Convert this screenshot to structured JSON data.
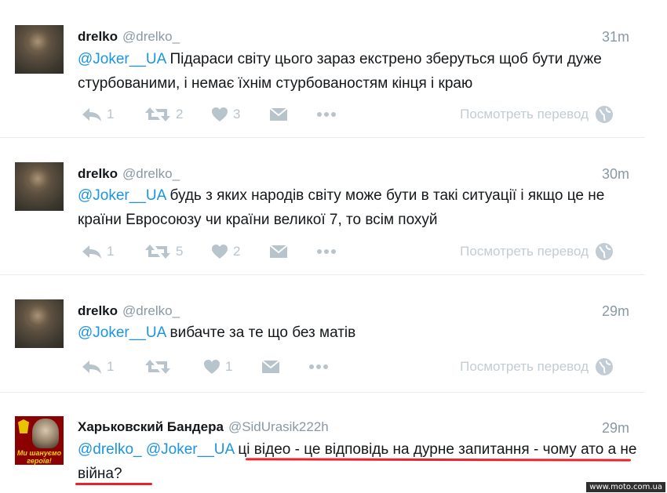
{
  "tweets": [
    {
      "name": "drelko",
      "handle": "@drelko_",
      "time": "31m",
      "mentions": "@Joker__UA",
      "text": " Підараси світу цього зараз екстрено зберуться щоб бути  дуже стурбованими, і немає їхнім стурбованостям кінця і краю",
      "reply_count": "1",
      "retweet_count": "2",
      "like_count": "3",
      "translate_label": "Посмотреть перевод"
    },
    {
      "name": "drelko",
      "handle": "@drelko_",
      "time": "30m",
      "mentions": "@Joker__UA",
      "text": " будь з яких народів світу може бути в такі ситуації і якщо це не країни Евросоюзу чи країни великої 7, то всім похуй",
      "reply_count": "1",
      "retweet_count": "5",
      "like_count": "2",
      "translate_label": "Посмотреть перевод"
    },
    {
      "name": "drelko",
      "handle": "@drelko_",
      "time": "29m",
      "mentions": "@Joker__UA",
      "text": " вибачте за те що без матів",
      "reply_count": "1",
      "retweet_count": "",
      "like_count": "1",
      "translate_label": "Посмотреть перевод"
    },
    {
      "name": "Харьковский Бандера",
      "handle": "@SidUrasik222h",
      "time": "29m",
      "mentions": "@drelko_ @Joker__UA",
      "text": " ці відео - це відповідь на дурне запитання - чому ато а не війна?",
      "avatar_caption": "Ми шануємо героїв!"
    }
  ],
  "watermark": "www.moto.com.ua",
  "colors": {
    "mention": "#1b95e0",
    "muted": "#8899a6",
    "action": "#b8c4cc",
    "underline": "#e8232b"
  }
}
